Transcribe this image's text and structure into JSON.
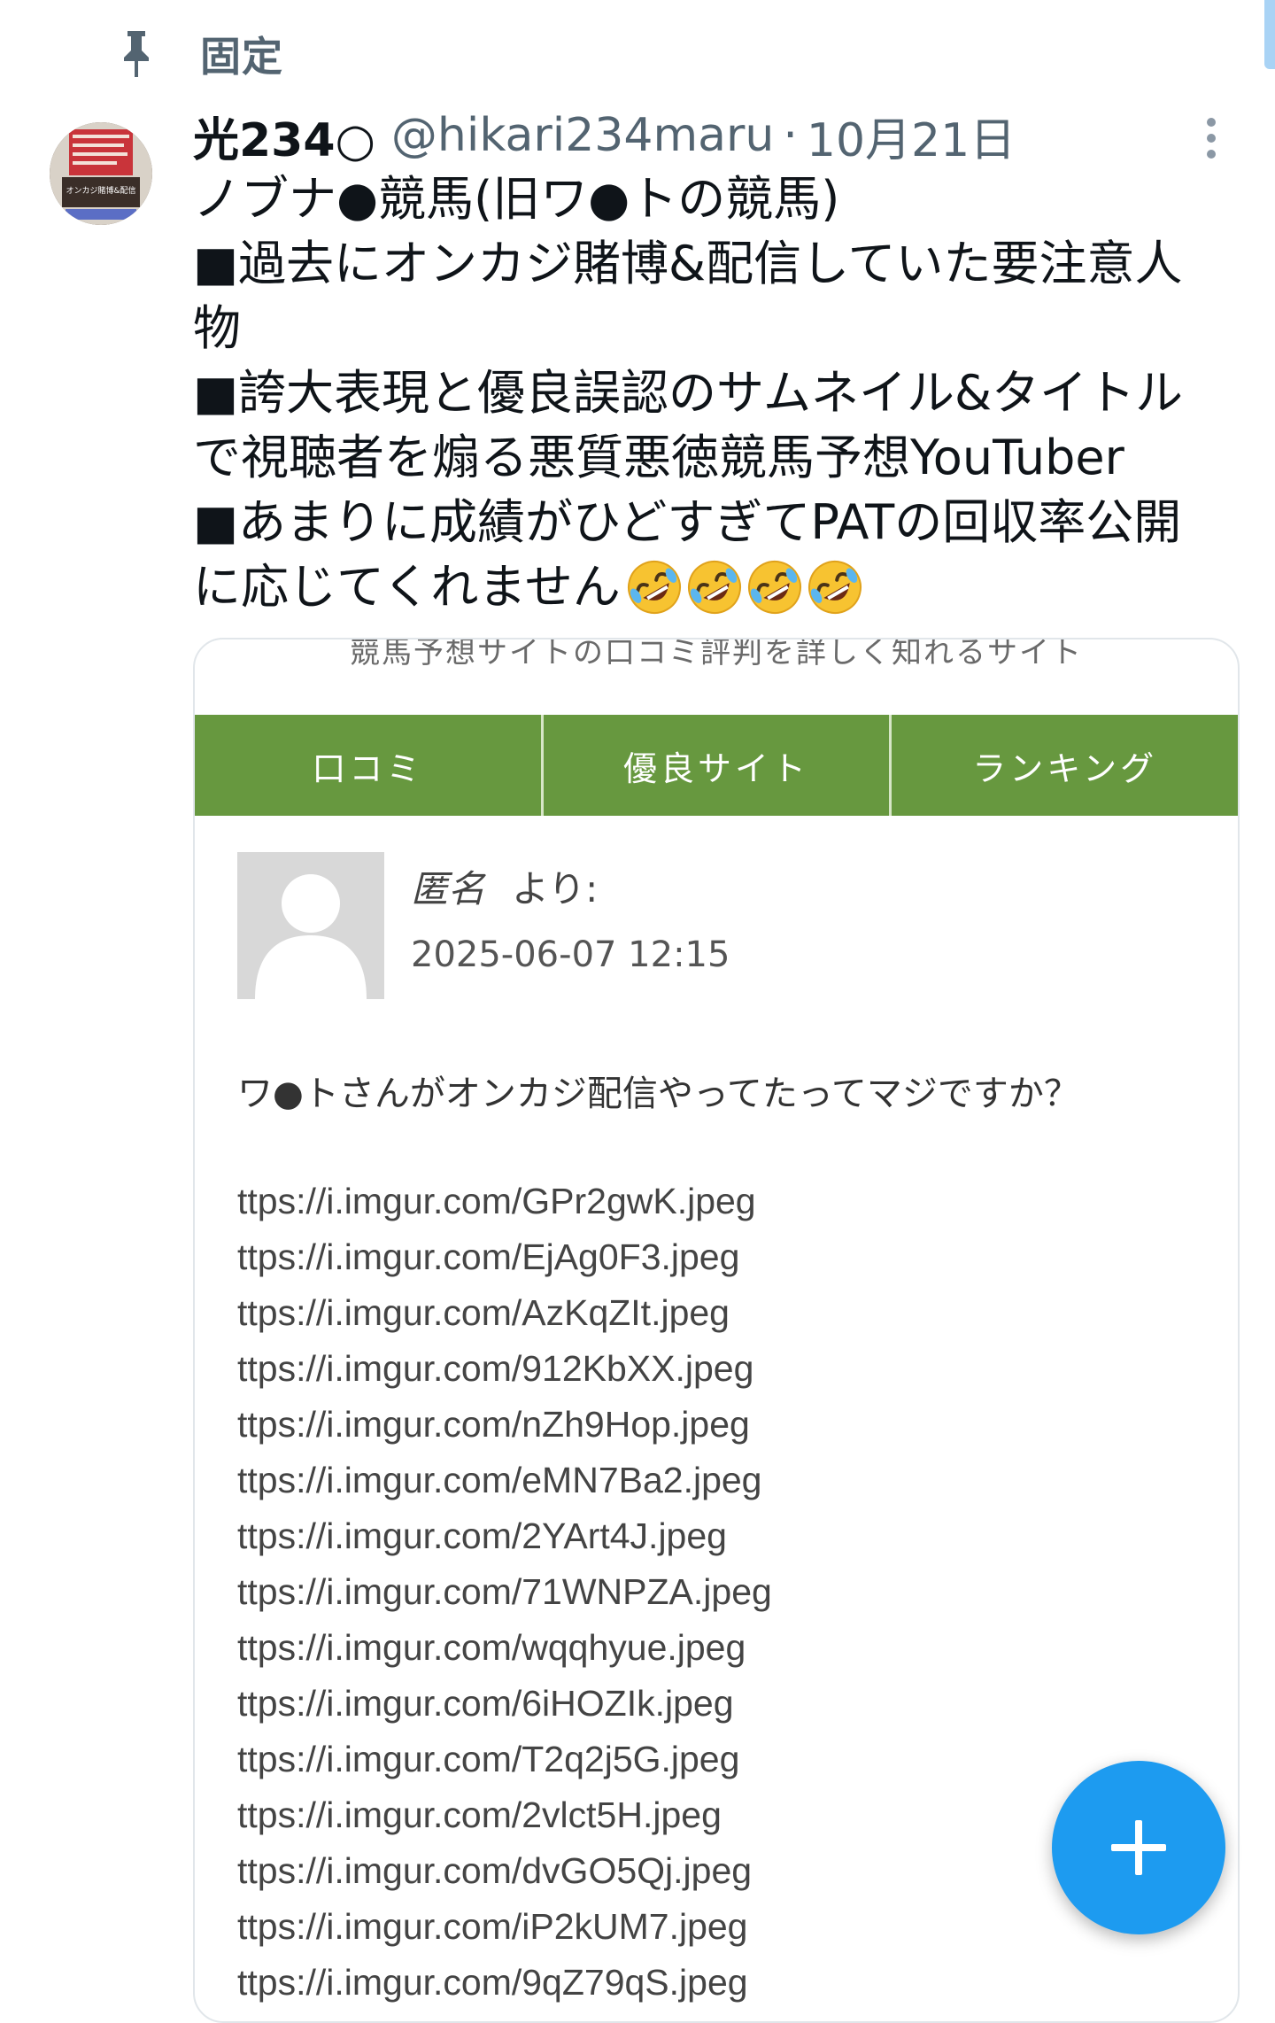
{
  "pinned": {
    "label": "固定"
  },
  "tweet": {
    "display_name": "光234○",
    "handle": "@hikari234maru",
    "separator": "·",
    "date": "10月21日",
    "lines": [
      "ノブナ●競馬(旧ワ●トの競馬)",
      "■過去にオンカジ賭博&配信していた要注意人",
      "物",
      "■誇大表現と優良誤認のサムネイル&タイトル",
      "で視聴者を煽る悪質悪徳競馬予想YouTuber",
      "■あまりに成績がひどすぎてPATの回収率公開",
      "に応じてくれません"
    ],
    "emoji_count": 4,
    "avatar_text": "オンカジ賭博&配信"
  },
  "screenshot": {
    "site_header": "競馬予想サイトの口コミ評判を詳しく知れるサイト",
    "nav": [
      "口コミ",
      "優良サイト",
      "ランキング"
    ],
    "comment": {
      "author": "匿名",
      "from": "より:",
      "date": "2025-06-07 12:15",
      "text": "ワ●トさんがオンカジ配信やってたってマジですか？"
    },
    "links": [
      "ttps://i.imgur.com/GPr2gwK.jpeg",
      "ttps://i.imgur.com/EjAg0F3.jpeg",
      "ttps://i.imgur.com/AzKqZIt.jpeg",
      "ttps://i.imgur.com/912KbXX.jpeg",
      "ttps://i.imgur.com/nZh9Hop.jpeg",
      "ttps://i.imgur.com/eMN7Ba2.jpeg",
      "ttps://i.imgur.com/2YArt4J.jpeg",
      "ttps://i.imgur.com/71WNPZA.jpeg",
      "ttps://i.imgur.com/wqqhyue.jpeg",
      "ttps://i.imgur.com/6iHOZIk.jpeg",
      "ttps://i.imgur.com/T2q2j5G.jpeg",
      "ttps://i.imgur.com/2vlct5H.jpeg",
      "ttps://i.imgur.com/dvGO5Qj.jpeg",
      "ttps://i.imgur.com/iP2kUM7.jpeg",
      "ttps://i.imgur.com/9qZ79qS.jpeg"
    ]
  },
  "icons": {
    "pin": "pin-icon",
    "more": "more-vertical-icon",
    "emoji": "rolling-on-floor-laughing-emoji",
    "compose": "plus-icon"
  },
  "colors": {
    "accent": "#1d9bf0",
    "secondary_text": "#536471",
    "site_nav": "#67983f"
  }
}
